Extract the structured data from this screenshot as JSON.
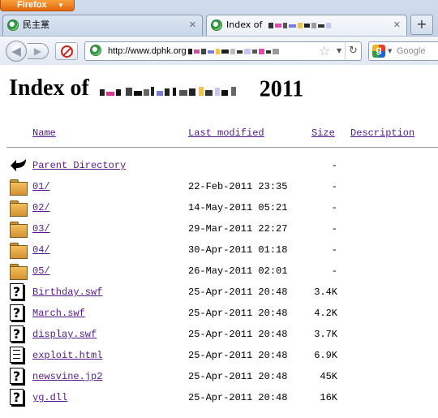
{
  "browser": {
    "app_button": "Firefox",
    "tabs": [
      {
        "label": "民主黨",
        "active": false
      },
      {
        "label": "Index of",
        "active": true
      }
    ],
    "new_tab": "+",
    "url": "http://www.dphk.org",
    "search_placeholder": "Google",
    "icons": {
      "back": "back-arrow-icon",
      "forward": "forward-arrow-icon",
      "stop": "stop-icon",
      "bookmark": "star-icon",
      "reload": "reload-icon",
      "search_engine": "google-icon"
    }
  },
  "page": {
    "title_prefix": "Index of",
    "title_suffix": "2011",
    "headers": {
      "name": "Name",
      "last_modified": "Last modified",
      "size": "Size",
      "description": "Description"
    },
    "entries": [
      {
        "icon": "back-arrow-icon",
        "name": "Parent Directory",
        "modified": "",
        "size": "-"
      },
      {
        "icon": "folder-icon",
        "name": "01/",
        "modified": "22-Feb-2011 23:35",
        "size": "-"
      },
      {
        "icon": "folder-icon",
        "name": "02/",
        "modified": "14-May-2011 05:21",
        "size": "-"
      },
      {
        "icon": "folder-icon",
        "name": "03/",
        "modified": "29-Mar-2011 22:27",
        "size": "-"
      },
      {
        "icon": "folder-icon",
        "name": "04/",
        "modified": "30-Apr-2011 01:18",
        "size": "-"
      },
      {
        "icon": "folder-icon",
        "name": "05/",
        "modified": "26-May-2011 02:01",
        "size": "-"
      },
      {
        "icon": "unknown-file-icon",
        "name": "Birthday.swf",
        "modified": "25-Apr-2011 20:48",
        "size": "3.4K"
      },
      {
        "icon": "unknown-file-icon",
        "name": "March.swf",
        "modified": "25-Apr-2011 20:48",
        "size": "4.2K"
      },
      {
        "icon": "unknown-file-icon",
        "name": "display.swf",
        "modified": "25-Apr-2011 20:48",
        "size": "3.7K"
      },
      {
        "icon": "text-file-icon",
        "name": "exploit.html",
        "modified": "25-Apr-2011 20:48",
        "size": "6.9K"
      },
      {
        "icon": "unknown-file-icon",
        "name": "newsvine.jp2",
        "modified": "25-Apr-2011 20:48",
        "size": "45K"
      },
      {
        "icon": "unknown-file-icon",
        "name": "yg.dll",
        "modified": "25-Apr-2011 20:48",
        "size": "16K"
      }
    ]
  },
  "colors": {
    "link": "#551a8b",
    "chrome_bg": "#c9d7e9",
    "firefox_button": "#e2670e"
  }
}
